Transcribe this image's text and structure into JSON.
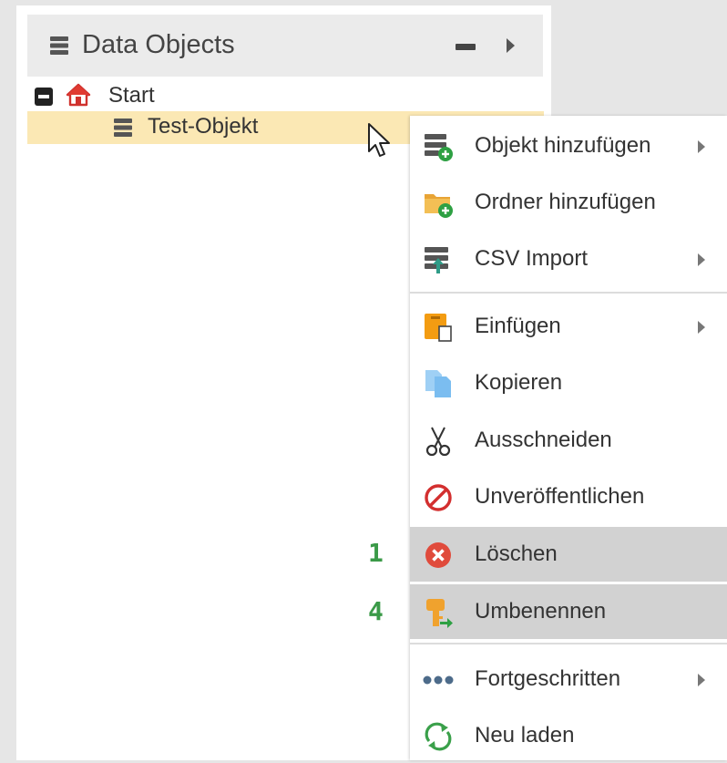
{
  "panel": {
    "title": "Data Objects",
    "header_icon": "database-icon",
    "collapse_icon": "minus-icon",
    "expand_icon": "caret-right-icon"
  },
  "tree": {
    "items": [
      {
        "label": "Start",
        "icon": "home-icon",
        "toggle": "collapse-box-icon"
      },
      {
        "label": "Test-Objekt",
        "icon": "database-icon",
        "selected": true
      }
    ]
  },
  "context_menu": {
    "items": [
      {
        "label": "Objekt hinzufügen",
        "icon": "add-object-icon",
        "submenu": true
      },
      {
        "label": "Ordner hinzufügen",
        "icon": "add-folder-icon",
        "submenu": false
      },
      {
        "label": "CSV Import",
        "icon": "csv-import-icon",
        "submenu": true
      },
      {
        "label": "Einfügen",
        "icon": "paste-icon",
        "submenu": true
      },
      {
        "label": "Kopieren",
        "icon": "copy-icon",
        "submenu": false
      },
      {
        "label": "Ausschneiden",
        "icon": "scissors-icon",
        "submenu": false
      },
      {
        "label": "Unveröffentlichen",
        "icon": "unpublish-icon",
        "submenu": false
      },
      {
        "label": "Löschen",
        "icon": "delete-icon",
        "submenu": false,
        "highlighted": true
      },
      {
        "label": "Umbenennen",
        "icon": "rename-key-icon",
        "submenu": false,
        "highlighted": true
      },
      {
        "label": "Fortgeschritten",
        "icon": "more-dots-icon",
        "submenu": true
      },
      {
        "label": "Neu laden",
        "icon": "reload-icon",
        "submenu": false
      }
    ]
  },
  "annotations": {
    "step_delete": "1",
    "step_rename": "4"
  },
  "colors": {
    "selection": "#fbe8b4",
    "hover": "#d2d2d2",
    "annotation": "#3b9a48"
  }
}
